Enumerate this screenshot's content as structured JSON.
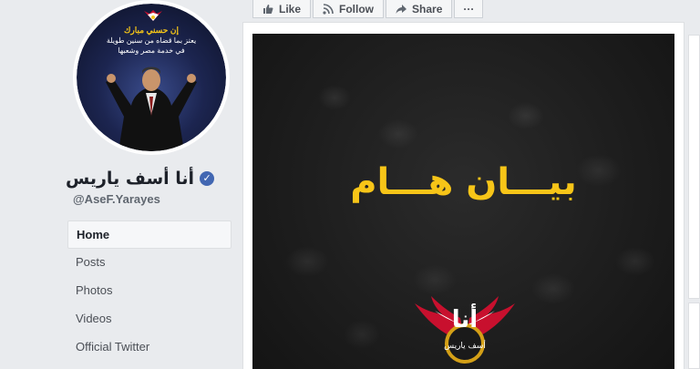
{
  "profile": {
    "page_name": "أنا أسف ياريس",
    "username": "@AseF.Yarayes",
    "picture_text": {
      "line1": "إن حسني مبارك",
      "line2": "يعتز بما قضاه من سنين طويلة",
      "line3": "في خدمة مصر وشعبها"
    }
  },
  "nav": {
    "items": [
      {
        "label": "Home",
        "active": true
      },
      {
        "label": "Posts"
      },
      {
        "label": "Photos"
      },
      {
        "label": "Videos"
      },
      {
        "label": "Official Twitter"
      }
    ]
  },
  "actions": {
    "like": "Like",
    "follow": "Follow",
    "share": "Share",
    "more": "···"
  },
  "post": {
    "headline": "بيـــان هـــام",
    "emblem_text_big": "أنا",
    "emblem_text_small": "أسف ياريس"
  },
  "colors": {
    "accent": "#4267b2",
    "headline": "#f7c518"
  }
}
